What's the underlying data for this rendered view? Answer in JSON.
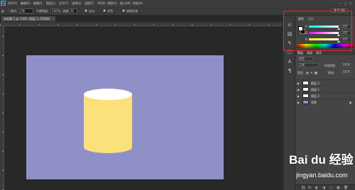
{
  "app": {
    "icon_text": "Ps"
  },
  "menu": {
    "items": [
      "文件(F)",
      "编辑(E)",
      "图像(I)",
      "图层(L)",
      "文字(Y)",
      "选择(S)",
      "滤镜(T)",
      "3D(D)",
      "视图(V)",
      "窗口(W)",
      "帮助(H)"
    ]
  },
  "window_controls": [
    "—",
    "□",
    "×"
  ],
  "options": {
    "mode_label": "模式:",
    "mode_value": "正常",
    "opacity_label": "不透明度:",
    "opacity_value": "100%",
    "flow_label": "流量:",
    "flow_value": "32",
    "reverse_label": "反向",
    "dither_label": "仿色",
    "transparency_label": "透明区域",
    "workspace": "基本功能"
  },
  "document": {
    "tab_title": "未标题-1 @ 100% (图层 3, RGB/8)"
  },
  "canvas": {
    "background_color": "#9090c8",
    "cylinder_body_color": "#fce07a",
    "cylinder_top_color": "#ffffff"
  },
  "color_panel": {
    "tab_color": "颜色",
    "tab_swatches": "色板",
    "foreground": "#ffffff",
    "background": "#000000",
    "sliders": [
      {
        "letter": "R",
        "value": "255",
        "fraction": 1.0
      },
      {
        "letter": "G",
        "value": "255",
        "fraction": 1.0
      },
      {
        "letter": "B",
        "value": "255",
        "fraction": 1.0
      }
    ]
  },
  "layers_panel": {
    "tabs": [
      "图层",
      "通道",
      "路径"
    ],
    "kind_label": "类型",
    "blend_mode": "正常",
    "opacity_label": "不透明度:",
    "opacity_value": "100%",
    "lock_label": "锁定:",
    "fill_label": "填充:",
    "fill_value": "100%",
    "layers": [
      {
        "name": "图层 3",
        "thumb": "#ffffff"
      },
      {
        "name": "图层 1",
        "thumb": "#ffffff"
      },
      {
        "name": "图层 2",
        "thumb": "#ffffff"
      },
      {
        "name": "背景",
        "thumb": "#9090c8"
      }
    ]
  },
  "watermark": {
    "brand": "Bai du 经验",
    "url": "jingyan.baidu.com"
  },
  "colors": {
    "highlight": "#d9302a",
    "panel_bg": "#454545",
    "app_bg": "#282828"
  }
}
